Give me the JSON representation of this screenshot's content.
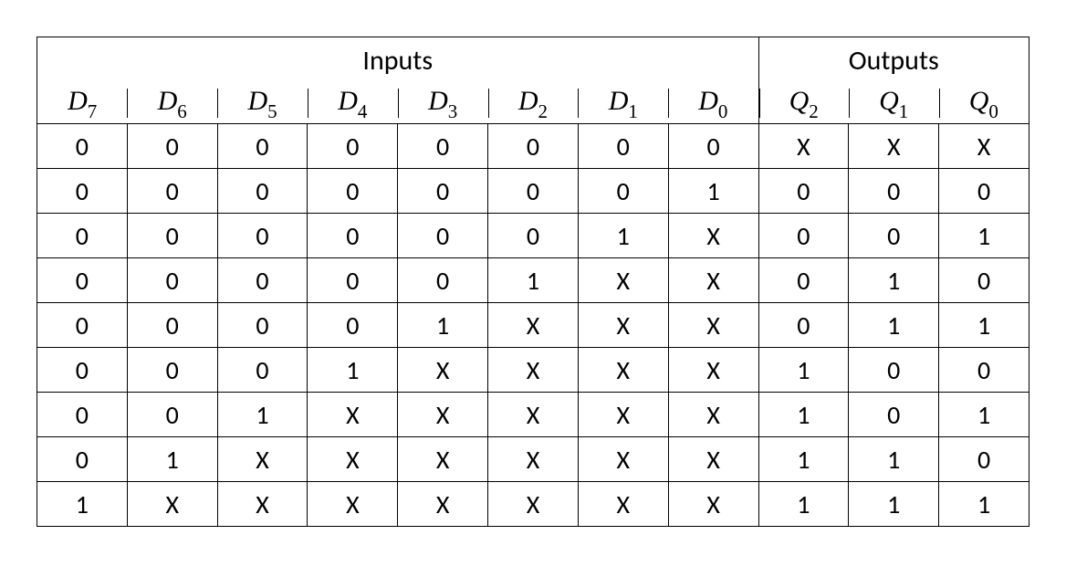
{
  "groups": {
    "inputs": "Inputs",
    "outputs": "Outputs"
  },
  "columns": {
    "d7": {
      "base": "D",
      "sub": "7"
    },
    "d6": {
      "base": "D",
      "sub": "6"
    },
    "d5": {
      "base": "D",
      "sub": "5"
    },
    "d4": {
      "base": "D",
      "sub": "4"
    },
    "d3": {
      "base": "D",
      "sub": "3"
    },
    "d2": {
      "base": "D",
      "sub": "2"
    },
    "d1": {
      "base": "D",
      "sub": "1"
    },
    "d0": {
      "base": "D",
      "sub": "0"
    },
    "q2": {
      "base": "Q",
      "sub": "2"
    },
    "q1": {
      "base": "Q",
      "sub": "1"
    },
    "q0": {
      "base": "Q",
      "sub": "0"
    }
  },
  "rows": [
    {
      "d7": "0",
      "d6": "0",
      "d5": "0",
      "d4": "0",
      "d3": "0",
      "d2": "0",
      "d1": "0",
      "d0": "0",
      "q2": "X",
      "q1": "X",
      "q0": "X"
    },
    {
      "d7": "0",
      "d6": "0",
      "d5": "0",
      "d4": "0",
      "d3": "0",
      "d2": "0",
      "d1": "0",
      "d0": "1",
      "q2": "0",
      "q1": "0",
      "q0": "0"
    },
    {
      "d7": "0",
      "d6": "0",
      "d5": "0",
      "d4": "0",
      "d3": "0",
      "d2": "0",
      "d1": "1",
      "d0": "X",
      "q2": "0",
      "q1": "0",
      "q0": "1"
    },
    {
      "d7": "0",
      "d6": "0",
      "d5": "0",
      "d4": "0",
      "d3": "0",
      "d2": "1",
      "d1": "X",
      "d0": "X",
      "q2": "0",
      "q1": "1",
      "q0": "0"
    },
    {
      "d7": "0",
      "d6": "0",
      "d5": "0",
      "d4": "0",
      "d3": "1",
      "d2": "X",
      "d1": "X",
      "d0": "X",
      "q2": "0",
      "q1": "1",
      "q0": "1"
    },
    {
      "d7": "0",
      "d6": "0",
      "d5": "0",
      "d4": "1",
      "d3": "X",
      "d2": "X",
      "d1": "X",
      "d0": "X",
      "q2": "1",
      "q1": "0",
      "q0": "0"
    },
    {
      "d7": "0",
      "d6": "0",
      "d5": "1",
      "d4": "X",
      "d3": "X",
      "d2": "X",
      "d1": "X",
      "d0": "X",
      "q2": "1",
      "q1": "0",
      "q0": "1"
    },
    {
      "d7": "0",
      "d6": "1",
      "d5": "X",
      "d4": "X",
      "d3": "X",
      "d2": "X",
      "d1": "X",
      "d0": "X",
      "q2": "1",
      "q1": "1",
      "q0": "0"
    },
    {
      "d7": "1",
      "d6": "X",
      "d5": "X",
      "d4": "X",
      "d3": "X",
      "d2": "X",
      "d1": "X",
      "d0": "X",
      "q2": "1",
      "q1": "1",
      "q0": "1"
    }
  ]
}
